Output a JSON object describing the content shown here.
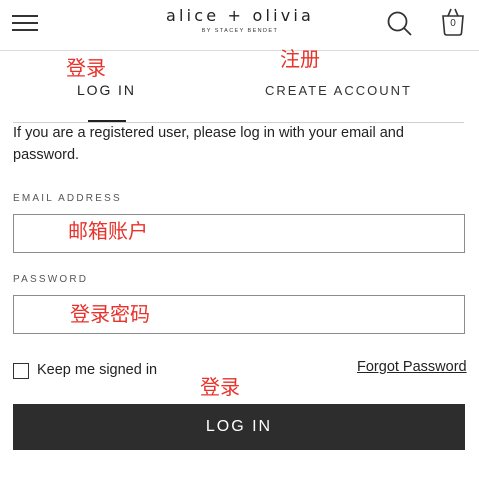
{
  "header": {
    "logo_name": "alice + olivia",
    "logo_sub": "BY STACEY BENDET",
    "bag_count": "0"
  },
  "annotations": {
    "login_tab": "登录",
    "register_tab": "注册",
    "email": "邮箱账户",
    "password": "登录密码",
    "login_button": "登录"
  },
  "tabs": {
    "login": "LOG IN",
    "create": "CREATE ACCOUNT"
  },
  "form": {
    "intro": "If you are a registered user, please log in with your email and password.",
    "email_label": "EMAIL ADDRESS",
    "email_value": "",
    "password_label": "PASSWORD",
    "password_value": "",
    "keep_signed_in": "Keep me signed in",
    "forgot_password": "Forgot Password",
    "submit": "LOG IN"
  }
}
